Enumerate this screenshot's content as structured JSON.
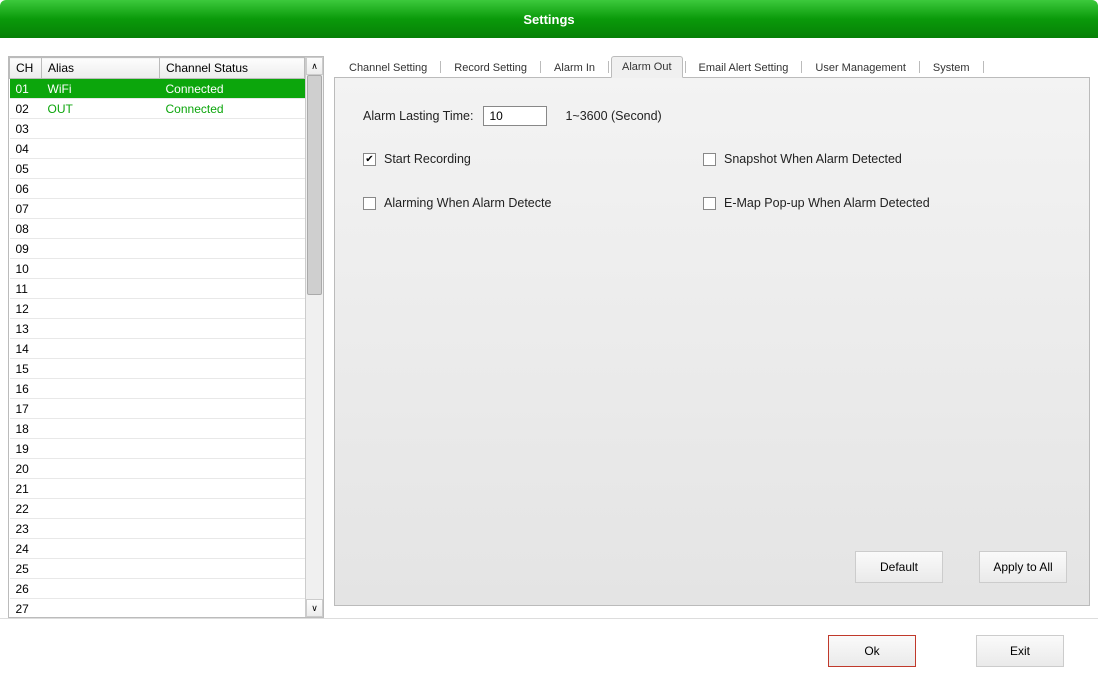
{
  "window": {
    "title": "Settings"
  },
  "table": {
    "headers": {
      "ch": "CH",
      "alias": "Alias",
      "status": "Channel Status"
    },
    "rows": [
      {
        "ch": "01",
        "alias": "WiFi",
        "status": "Connected",
        "selected": true
      },
      {
        "ch": "02",
        "alias": "OUT",
        "status": "Connected",
        "selected": false
      },
      {
        "ch": "03",
        "alias": "",
        "status": ""
      },
      {
        "ch": "04",
        "alias": "",
        "status": ""
      },
      {
        "ch": "05",
        "alias": "",
        "status": ""
      },
      {
        "ch": "06",
        "alias": "",
        "status": ""
      },
      {
        "ch": "07",
        "alias": "",
        "status": ""
      },
      {
        "ch": "08",
        "alias": "",
        "status": ""
      },
      {
        "ch": "09",
        "alias": "",
        "status": ""
      },
      {
        "ch": "10",
        "alias": "",
        "status": ""
      },
      {
        "ch": "11",
        "alias": "",
        "status": ""
      },
      {
        "ch": "12",
        "alias": "",
        "status": ""
      },
      {
        "ch": "13",
        "alias": "",
        "status": ""
      },
      {
        "ch": "14",
        "alias": "",
        "status": ""
      },
      {
        "ch": "15",
        "alias": "",
        "status": ""
      },
      {
        "ch": "16",
        "alias": "",
        "status": ""
      },
      {
        "ch": "17",
        "alias": "",
        "status": ""
      },
      {
        "ch": "18",
        "alias": "",
        "status": ""
      },
      {
        "ch": "19",
        "alias": "",
        "status": ""
      },
      {
        "ch": "20",
        "alias": "",
        "status": ""
      },
      {
        "ch": "21",
        "alias": "",
        "status": ""
      },
      {
        "ch": "22",
        "alias": "",
        "status": ""
      },
      {
        "ch": "23",
        "alias": "",
        "status": ""
      },
      {
        "ch": "24",
        "alias": "",
        "status": ""
      },
      {
        "ch": "25",
        "alias": "",
        "status": ""
      },
      {
        "ch": "26",
        "alias": "",
        "status": ""
      },
      {
        "ch": "27",
        "alias": "",
        "status": ""
      }
    ]
  },
  "tabs": {
    "items": [
      {
        "label": "Channel Setting"
      },
      {
        "label": "Record Setting"
      },
      {
        "label": "Alarm In"
      },
      {
        "label": "Alarm Out"
      },
      {
        "label": "Email Alert Setting"
      },
      {
        "label": "User Management"
      },
      {
        "label": "System"
      }
    ],
    "active_index": 3
  },
  "alarm_out": {
    "lasting_label": "Alarm Lasting Time:",
    "lasting_value": "10",
    "lasting_hint": "1~3600 (Second)",
    "start_recording": {
      "label": "Start Recording",
      "checked": true
    },
    "snapshot": {
      "label": "Snapshot When Alarm Detected",
      "checked": false
    },
    "alarming": {
      "label": "Alarming When Alarm Detecte",
      "checked": false
    },
    "emap": {
      "label": "E-Map Pop-up When Alarm Detected",
      "checked": false
    }
  },
  "buttons": {
    "default": "Default",
    "apply_all": "Apply to All",
    "ok": "Ok",
    "exit": "Exit"
  }
}
